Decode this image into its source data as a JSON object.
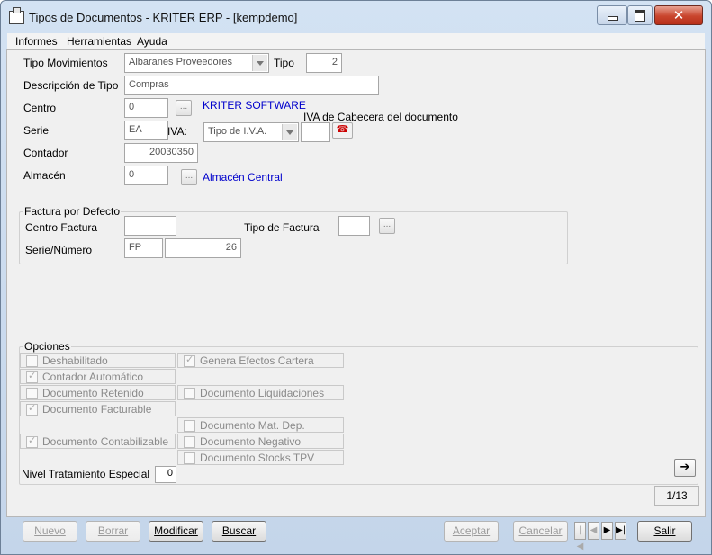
{
  "window": {
    "title": "Tipos de Documentos - KRITER ERP - [kempdemo]"
  },
  "menu": [
    "Informes",
    "Herramientas",
    "Ayuda"
  ],
  "form": {
    "tipo_mov_label": "Tipo Movimientos",
    "tipo_mov_value": "Albaranes Proveedores",
    "tipo_label": "Tipo",
    "tipo_value": "2",
    "desc_label": "Descripción de Tipo",
    "desc_value": "Compras",
    "centro_label": "Centro",
    "centro_value": "0",
    "centro_name": "KRITER SOFTWARE",
    "serie_label": "Serie",
    "serie_value": "EA",
    "iva_label": "IVA:",
    "iva_value": "Tipo de I.V.A.",
    "iva_cab_label": "IVA de Cabecera del documento",
    "contador_label": "Contador",
    "contador_value": "20030350",
    "almacen_label": "Almacén",
    "almacen_value": "0",
    "almacen_name": "Almacén Central",
    "dots": "..."
  },
  "factura": {
    "title": "Factura por Defecto",
    "centro_label": "Centro Factura",
    "centro_value": "",
    "tipo_label": "Tipo de Factura",
    "tipo_value": "",
    "serie_label": "Serie/Número",
    "serie_value": "FP",
    "numero_value": "26"
  },
  "opciones": {
    "title": "Opciones",
    "left": [
      {
        "label": "Deshabilitado",
        "checked": false
      },
      {
        "label": "Contador Automático",
        "checked": true
      },
      {
        "label": "Documento Retenido",
        "checked": false
      },
      {
        "label": "Documento Facturable",
        "checked": true
      },
      {
        "label": "Documento Contabilizable",
        "checked": true
      }
    ],
    "right": [
      {
        "label": "Genera Efectos Cartera",
        "checked": true
      },
      {
        "label": "Documento Liquidaciones",
        "checked": false
      },
      {
        "label": "Documento Mat. Dep.",
        "checked": false
      },
      {
        "label": "Documento Negativo",
        "checked": false
      },
      {
        "label": "Documento Stocks TPV",
        "checked": false
      }
    ],
    "nivel_label": "Nivel Tratamiento Especial",
    "nivel_value": "0"
  },
  "record_counter": "1/13",
  "buttons": {
    "nuevo": "Nuevo",
    "borrar": "Borrar",
    "modificar": "Modificar",
    "buscar": "Buscar",
    "aceptar": "Aceptar",
    "cancelar": "Cancelar",
    "salir": "Salir"
  }
}
